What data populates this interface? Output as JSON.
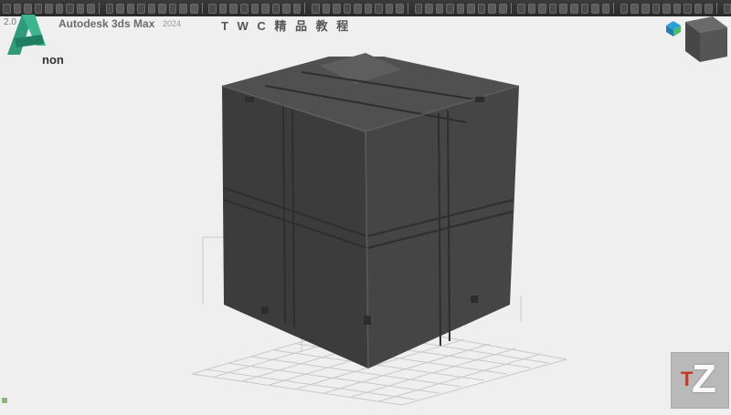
{
  "title_left": "2.0",
  "app_title": "Autodesk 3ds Max",
  "app_version": "2024",
  "channel_name": "T W C 精 品 教 程",
  "logo_text": "non",
  "watermark": {
    "letter_small": "T",
    "letter_large": "Z"
  },
  "toolbar": {
    "button_count": 64
  },
  "colors": {
    "viewport_bg": "#efefef",
    "object_dark": "#3e3e3e",
    "object_top": "#545454",
    "grid_line": "#c8c8c8",
    "logo_green": "#2e9b7a",
    "viewcube_accent": "#2aa0d8"
  },
  "icons": [
    "app-logo-icon",
    "viewcube-icon",
    "home-viewcube-icon",
    "toolbar-button-icon"
  ]
}
